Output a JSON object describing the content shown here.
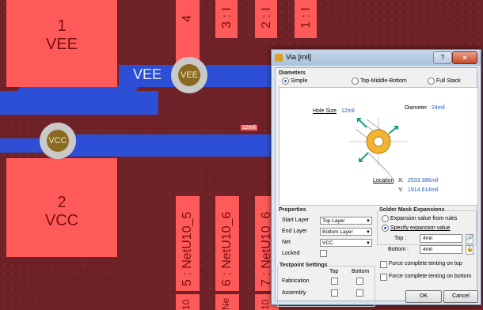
{
  "pcb": {
    "pad_top": {
      "number": "1",
      "net": "VEE"
    },
    "pad_bottom": {
      "number": "2",
      "net": "VCC"
    },
    "top_pins": [
      "4",
      "3 : I",
      "2 : I",
      "1 : I"
    ],
    "bottom_pins": [
      "5 : NetU10_5",
      "6 : NetU10_6",
      "7 : NetU10_6"
    ],
    "bottom_pin_fragments": [
      "10",
      "Ne",
      "10"
    ],
    "trace_label": "VEE",
    "via_vee": "VEE",
    "via_vcc": "VCC",
    "small_tag": "12mil"
  },
  "dialog": {
    "title": "Via [mil]",
    "diameters": {
      "group_title": "Diameters",
      "options": [
        "Simple",
        "Top-Middle-Bottom",
        "Full Stack"
      ],
      "selected": "Simple"
    },
    "diagram": {
      "hole_size_label": "Hole Size",
      "hole_size_value": "12mil",
      "diameter_label": "Diameter",
      "diameter_value": "24mil",
      "location_label": "Location",
      "x_label": "X:",
      "x_value": "2533.386mil",
      "y_label": "Y:",
      "y_value": "1914.614mil"
    },
    "properties": {
      "group_title": "Properties",
      "start_layer_label": "Start Layer",
      "start_layer_value": "Top Layer",
      "end_layer_label": "End Layer",
      "end_layer_value": "Bottom Layer",
      "net_label": "Net",
      "net_value": "VCC",
      "locked_label": "Locked"
    },
    "testpoint": {
      "group_title": "Testpoint Settings",
      "col_top": "Top",
      "col_bottom": "Bottom",
      "fabrication_label": "Fabrication",
      "assembly_label": "Assembly"
    },
    "solder_mask": {
      "group_title": "Solder Mask Expansions",
      "option_rules": "Expansion value from rules",
      "option_specify": "Specify expansion value",
      "selected": "Specify expansion value",
      "top_label": "Top :",
      "top_value": "4mil",
      "bottom_label": "Bottom :",
      "bottom_value": "4mil",
      "tent_top": "Force complete tenting on top",
      "tent_bottom": "Force complete tenting on bottom"
    },
    "buttons": {
      "ok": "OK",
      "cancel": "Cancel"
    }
  },
  "colors": {
    "board": "#6e2126",
    "pad": "#ff5a5a",
    "trace": "#2c4fd6",
    "via_ring": "#c9c9c9",
    "via_core": "#8a6a20",
    "dialog_accent": "#1f5fbf"
  }
}
